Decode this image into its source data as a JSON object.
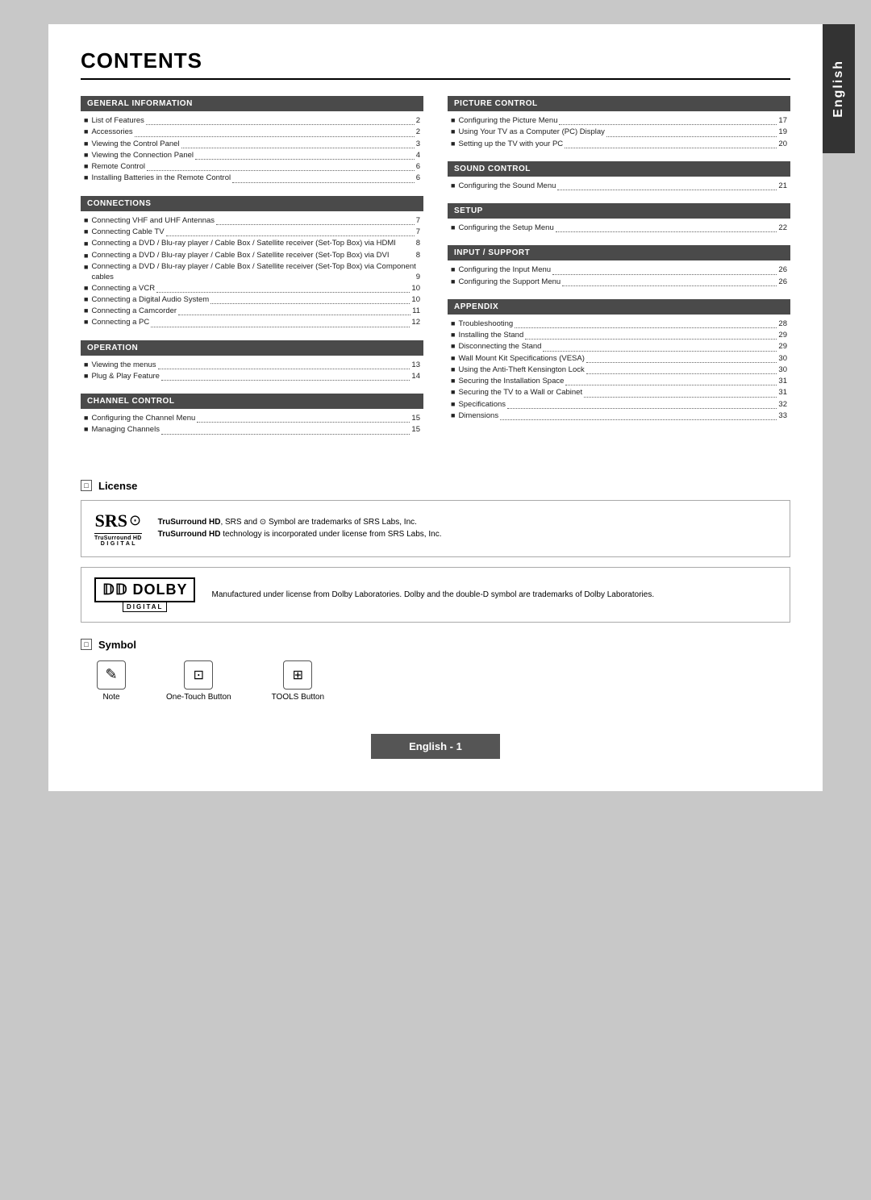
{
  "page": {
    "title": "CONTENTS",
    "side_tab": "English",
    "footer": "English - 1"
  },
  "left_column": {
    "sections": [
      {
        "id": "general-information",
        "header": "GENERAL INFORMATION",
        "items": [
          {
            "label": "List of Features",
            "page": "2"
          },
          {
            "label": "Accessories",
            "page": "2"
          },
          {
            "label": "Viewing the Control Panel",
            "page": "3"
          },
          {
            "label": "Viewing the Connection Panel",
            "page": "4"
          },
          {
            "label": "Remote Control",
            "page": "6"
          },
          {
            "label": "Installing Batteries in the Remote Control",
            "page": "6"
          }
        ]
      },
      {
        "id": "connections",
        "header": "CONNECTIONS",
        "items": [
          {
            "label": "Connecting VHF and UHF Antennas",
            "page": "7"
          },
          {
            "label": "Connecting Cable TV",
            "page": "7"
          },
          {
            "label": "Connecting a DVD / Blu-ray player / Cable Box / Satellite receiver (Set-Top Box) via HDMI",
            "page": "8",
            "multiline": true
          },
          {
            "label": "Connecting a DVD / Blu-ray player / Cable Box / Satellite receiver (Set-Top Box) via DVI",
            "page": "8",
            "multiline": true
          },
          {
            "label": "Connecting a DVD / Blu-ray player / Cable Box / Satellite receiver (Set-Top Box) via Component cables",
            "page": "9",
            "multiline": true
          },
          {
            "label": "Connecting a VCR",
            "page": "10"
          },
          {
            "label": "Connecting a Digital Audio System",
            "page": "10"
          },
          {
            "label": "Connecting a Camcorder",
            "page": "11"
          },
          {
            "label": "Connecting a PC",
            "page": "12"
          }
        ]
      },
      {
        "id": "operation",
        "header": "OPERATION",
        "items": [
          {
            "label": "Viewing the menus",
            "page": "13"
          },
          {
            "label": "Plug & Play Feature",
            "page": "14"
          }
        ]
      },
      {
        "id": "channel-control",
        "header": "CHANNEL CONTROL",
        "items": [
          {
            "label": "Configuring the Channel Menu",
            "page": "15"
          },
          {
            "label": "Managing Channels",
            "page": "15"
          }
        ]
      }
    ]
  },
  "right_column": {
    "sections": [
      {
        "id": "picture-control",
        "header": "PICTURE CONTROL",
        "items": [
          {
            "label": "Configuring the Picture Menu",
            "page": "17"
          },
          {
            "label": "Using Your TV as a Computer (PC) Display",
            "page": "19"
          },
          {
            "label": "Setting up the TV with your PC",
            "page": "20"
          }
        ]
      },
      {
        "id": "sound-control",
        "header": "SOUND CONTROL",
        "items": [
          {
            "label": "Configuring the Sound Menu",
            "page": "21"
          }
        ]
      },
      {
        "id": "setup",
        "header": "SETUP",
        "items": [
          {
            "label": "Configuring the Setup Menu",
            "page": "22"
          }
        ]
      },
      {
        "id": "input-support",
        "header": "INPUT / SUPPORT",
        "items": [
          {
            "label": "Configuring the Input Menu",
            "page": "26"
          },
          {
            "label": "Configuring the Support Menu",
            "page": "26"
          }
        ]
      },
      {
        "id": "appendix",
        "header": "APPENDIX",
        "items": [
          {
            "label": "Troubleshooting",
            "page": "28"
          },
          {
            "label": "Installing the Stand",
            "page": "29"
          },
          {
            "label": "Disconnecting the Stand",
            "page": "29"
          },
          {
            "label": "Wall Mount Kit Specifications (VESA)",
            "page": "30"
          },
          {
            "label": "Using the Anti-Theft Kensington Lock",
            "page": "30"
          },
          {
            "label": "Securing the Installation Space",
            "page": "31"
          },
          {
            "label": "Securing the TV to a Wall or Cabinet",
            "page": "31"
          },
          {
            "label": "Specifications",
            "page": "32"
          },
          {
            "label": "Dimensions",
            "page": "33"
          }
        ]
      }
    ]
  },
  "license": {
    "heading": "License",
    "srs": {
      "brand": "SRS",
      "logo_symbol": "⊙",
      "sub": "TruSurround HD\nD I G I T A L",
      "line1": "TruSurround HD, SRS and ⊙ Symbol are trademarks of SRS Labs, Inc.",
      "line2": "TruSurround HD technology is incorporated under license from SRS Labs, Inc."
    },
    "dolby": {
      "brand": "DOLBY",
      "sub": "DIGITAL",
      "text": "Manufactured under license from Dolby Laboratories. Dolby and the double-D symbol are trademarks of Dolby Laboratories."
    }
  },
  "symbol": {
    "heading": "Symbol",
    "items": [
      {
        "icon": "✎",
        "label": "Note"
      },
      {
        "icon": "⊡",
        "label": "One-Touch Button"
      },
      {
        "icon": "⊞",
        "label": "TOOLS Button"
      }
    ]
  }
}
